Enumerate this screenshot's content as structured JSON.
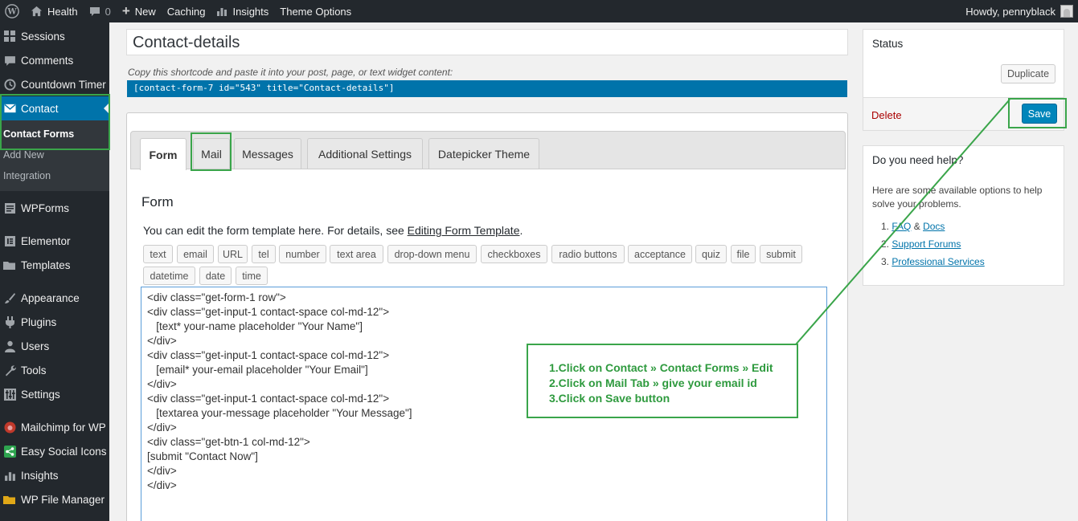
{
  "admin_bar": {
    "site_name": "Health",
    "comments_count": "0",
    "new_label": "New",
    "caching_label": "Caching",
    "insights_label": "Insights",
    "theme_options_label": "Theme Options",
    "greeting": "Howdy, pennyblack"
  },
  "sidebar": {
    "items": [
      {
        "label": "Sessions",
        "icon": "grid-icon"
      },
      {
        "label": "Comments",
        "icon": "comment-icon"
      },
      {
        "label": "Countdown Timer",
        "icon": "clock-icon"
      },
      {
        "label": "Contact",
        "icon": "mail-icon"
      },
      {
        "label": "WPForms",
        "icon": "forms-icon"
      },
      {
        "label": "Elementor",
        "icon": "elementor-icon"
      },
      {
        "label": "Templates",
        "icon": "folder-icon"
      },
      {
        "label": "Appearance",
        "icon": "brush-icon"
      },
      {
        "label": "Plugins",
        "icon": "plug-icon"
      },
      {
        "label": "Users",
        "icon": "user-icon"
      },
      {
        "label": "Tools",
        "icon": "wrench-icon"
      },
      {
        "label": "Settings",
        "icon": "settings-icon"
      },
      {
        "label": "Mailchimp for WP",
        "icon": "mailchimp-icon"
      },
      {
        "label": "Easy Social Icons",
        "icon": "share-icon"
      },
      {
        "label": "Insights",
        "icon": "chart-icon"
      },
      {
        "label": "WP File Manager",
        "icon": "file-manager-icon"
      }
    ],
    "submenu": [
      "Contact Forms",
      "Add New",
      "Integration"
    ]
  },
  "form_title": "Contact-details",
  "shortcode_hint": "Copy this shortcode and paste it into your post, page, or text widget content:",
  "shortcode": "[contact-form-7 id=\"543\" title=\"Contact-details\"]",
  "tabs": [
    "Form",
    "Mail",
    "Messages",
    "Additional Settings",
    "Datepicker Theme"
  ],
  "form_section": {
    "heading": "Form",
    "desc_prefix": "You can edit the form template here. For details, see ",
    "desc_link": "Editing Form Template",
    "desc_suffix": "."
  },
  "tag_buttons": [
    "text",
    "email",
    "URL",
    "tel",
    "number",
    "text area",
    "drop-down menu",
    "checkboxes",
    "radio buttons",
    "acceptance",
    "quiz",
    "file",
    "submit",
    "datetime",
    "date",
    "time"
  ],
  "code_lines": [
    "<div class=\"get-form-1 row\">",
    "<div class=\"get-input-1 contact-space col-md-12\">",
    "   [text* your-name placeholder \"Your Name\"]",
    "</div>",
    "<div class=\"get-input-1 contact-space col-md-12\">",
    "   [email* your-email placeholder \"Your Email\"]",
    "</div>",
    "<div class=\"get-input-1 contact-space col-md-12\">",
    "   [textarea your-message placeholder \"Your Message\"]",
    "</div>",
    "<div class=\"get-btn-1 col-md-12\">",
    "[submit \"Contact Now\"]",
    "</div>",
    "</div>"
  ],
  "annotation": [
    "1.Click on Contact » Contact Forms » Edit",
    "2.Click on Mail Tab » give your email id",
    "3.Click on Save button"
  ],
  "status_box": {
    "title": "Status",
    "duplicate_label": "Duplicate",
    "delete_label": "Delete",
    "save_label": "Save"
  },
  "help_box": {
    "title": "Do you need help?",
    "text": "Here are some available options to help solve your problems.",
    "faq": "FAQ",
    "amp": "&",
    "docs": "Docs",
    "support": "Support Forums",
    "professional": "Professional Services"
  },
  "colors": {
    "admin_dark": "#23282d",
    "accent_blue": "#0073aa",
    "annotation_green": "#3aa54a"
  }
}
